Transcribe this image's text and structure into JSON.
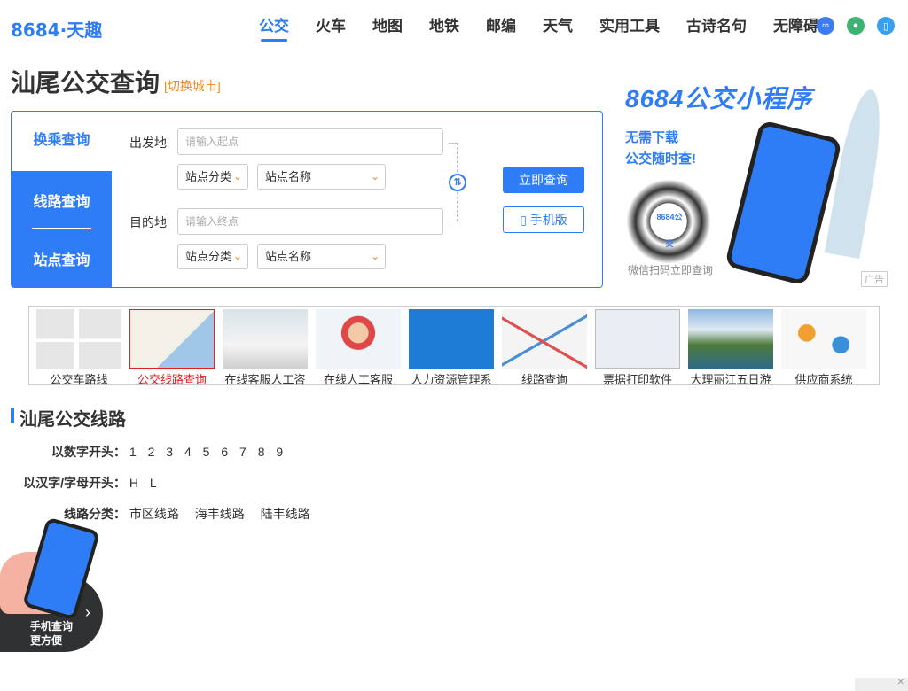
{
  "brand": {
    "logo_text": "8684·天趣"
  },
  "nav": {
    "items": [
      "公交",
      "火车",
      "地图",
      "地铁",
      "邮编",
      "天气",
      "实用工具",
      "古诗名句",
      "无障碍"
    ],
    "active": "公交"
  },
  "top_icons": [
    "mini-program-icon",
    "wechat-icon",
    "mobile-icon"
  ],
  "page": {
    "title": "汕尾公交查询",
    "switch_city": "[切换城市]"
  },
  "search": {
    "tabs": {
      "transfer": "换乘查询",
      "line": "线路查询",
      "station": "站点查询"
    },
    "from_label": "出发地",
    "to_label": "目的地",
    "from_placeholder": "请输入起点",
    "to_placeholder": "请输入终点",
    "category_select": "站点分类",
    "name_select": "站点名称",
    "query_button": "立即查询",
    "mobile_button": "手机版"
  },
  "ad_right": {
    "title": "8684公交小程序",
    "line1": "无需下载",
    "line2": "公交随时查!",
    "qr_text": "8684公交",
    "caption": "微信扫码立即查询",
    "tag": "广告"
  },
  "ad_strip": {
    "items": [
      "公交车路线",
      "公交线路查询",
      "在线客服人工咨",
      "在线人工客服",
      "人力资源管理系",
      "线路查询",
      "票据打印软件",
      "大理丽江五日游",
      "供应商系统"
    ],
    "highlighted_index": 1
  },
  "lines_section": {
    "title": "汕尾公交线路",
    "by_number_label": "以数字开头：",
    "by_number": [
      "1",
      "2",
      "3",
      "4",
      "5",
      "6",
      "7",
      "8",
      "9"
    ],
    "by_letter_label": "以汉字/字母开头：",
    "by_letter": [
      "H",
      "L"
    ],
    "category_label": "线路分类：",
    "categories": [
      "市区线路",
      "海丰线路",
      "陆丰线路"
    ]
  },
  "float_mobile": {
    "line1": "手机查询",
    "line2": "更方便"
  },
  "colors": {
    "accent": "#2f7df6",
    "orange": "#f28c24",
    "red": "#e02020"
  }
}
